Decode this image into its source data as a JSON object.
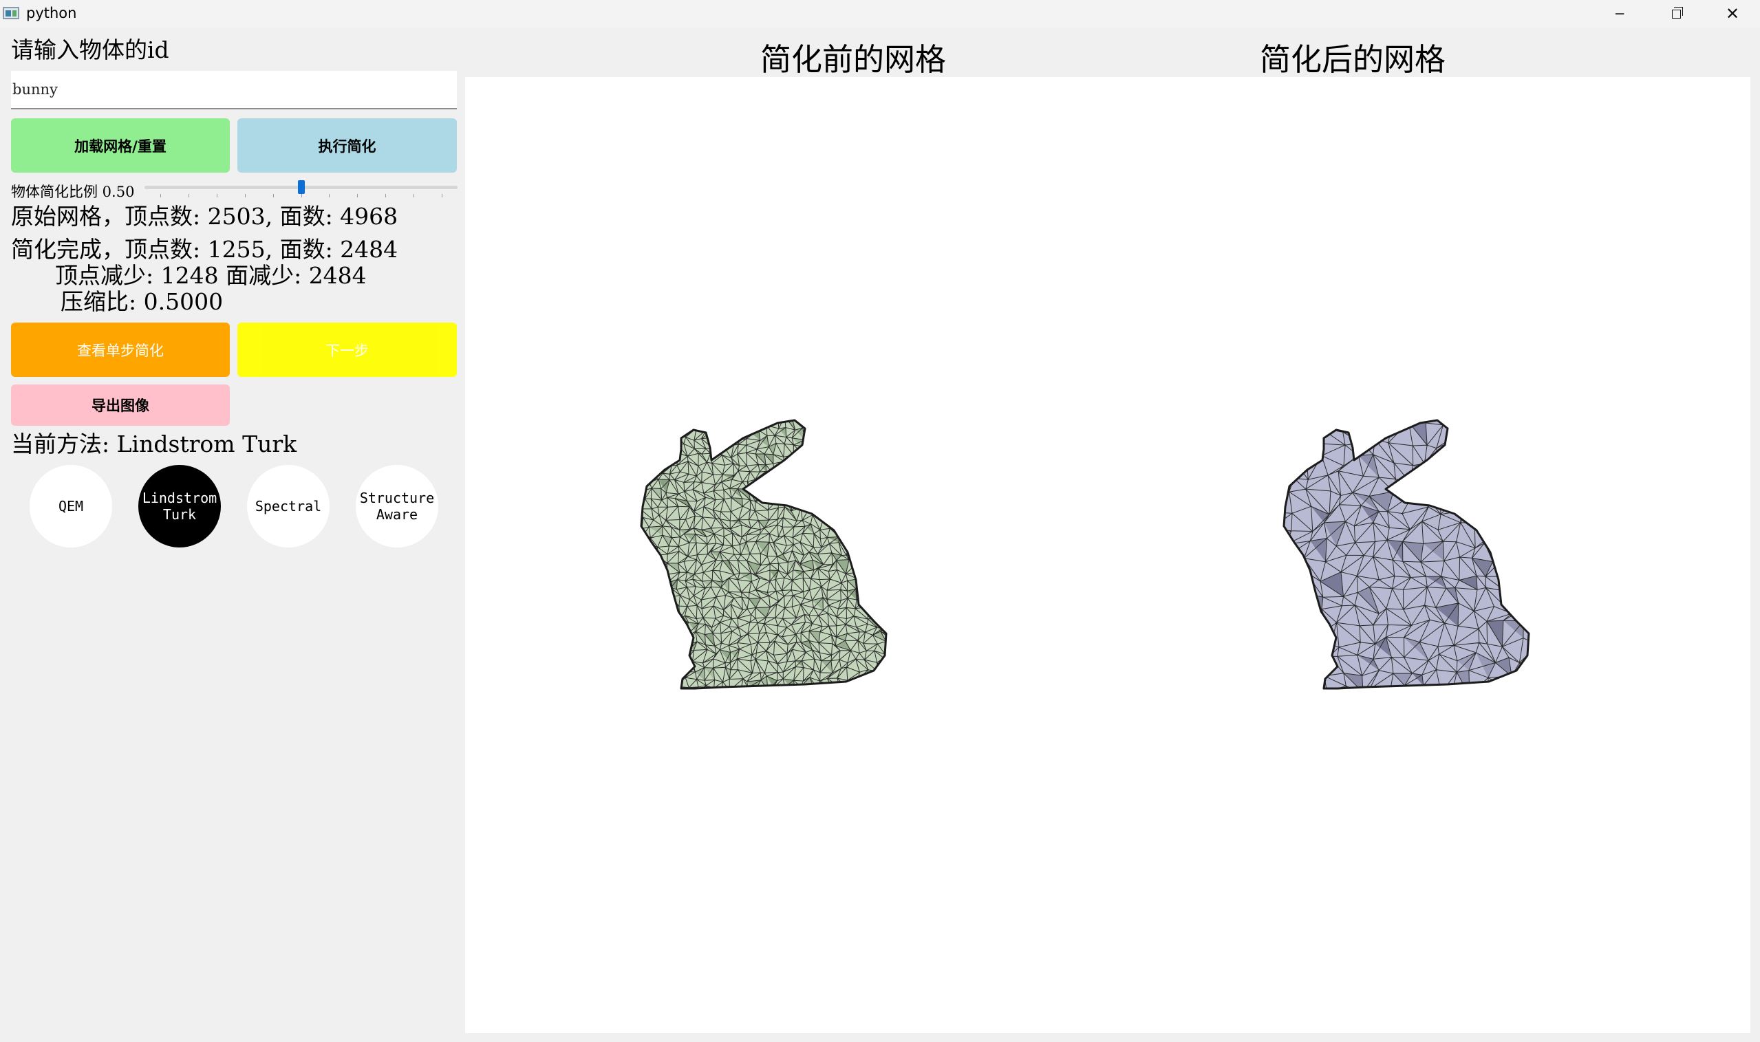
{
  "window": {
    "title": "python"
  },
  "panel": {
    "id_prompt": "请输入物体的id",
    "id_input_value": "bunny",
    "load_button": "加载网格/重置",
    "simplify_button": "执行简化",
    "ratio_label": "物体简化比例 0.50",
    "ratio_value": 0.5,
    "original_info": "原始网格，顶点数: 2503, 面数: 4968",
    "result_line1": "简化完成，顶点数: 1255, 面数: 2484",
    "result_line2": "顶点减少: 1248 面减少: 2484",
    "result_line3": "压缩比: 0.5000",
    "step_button": "查看单步简化",
    "next_button": "下一步",
    "export_button": "导出图像",
    "current_method": "当前方法: Lindstrom Turk",
    "methods": [
      {
        "label": "QEM",
        "active": false
      },
      {
        "label": "Lindstrom\nTurk",
        "active": true
      },
      {
        "label": "Spectral",
        "active": false
      },
      {
        "label": "Structure\nAware",
        "active": false
      }
    ]
  },
  "views": {
    "before_title": "简化前的网格",
    "after_title": "简化后的网格",
    "before_color": "#c3d6bc",
    "after_color": "#b8b9d3",
    "edge_color": "#2a2a2a"
  },
  "colors": {
    "load": "#90ee90",
    "simplify": "#add8e6",
    "step": "#ffa500",
    "next": "#ffff00",
    "export": "#ffc0cb",
    "slider": "#0a6fd8"
  }
}
